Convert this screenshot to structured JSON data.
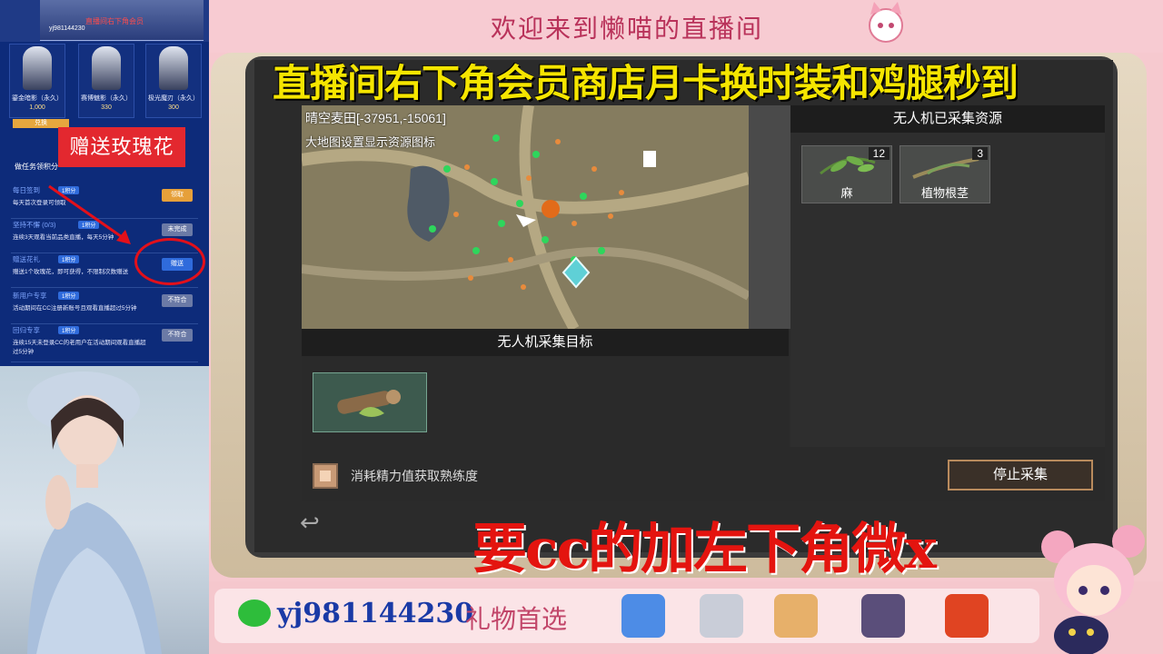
{
  "left_panel": {
    "top_banner_text": "yj981144230",
    "top_banner_red": "直播间右下角会员",
    "shop_items": [
      {
        "name": "鎏金暗影（永久）",
        "price": "1,000"
      },
      {
        "name": "赛博魅影（永久）",
        "price": "330"
      },
      {
        "name": "极光魔刃（永久）",
        "price": "300"
      }
    ],
    "exchange_label": "兑换",
    "rose_banner": "赠送玫瑰花",
    "task_section_title": "做任务领积分",
    "tasks": [
      {
        "name": "每日签到",
        "points": "1积分",
        "desc": "每天首次登录可领取",
        "button": "领取",
        "button_color": "#e6a03a"
      },
      {
        "name": "坚持不懈 (0/3)",
        "points": "1积分",
        "desc": "连续3天观看当前品类直播，每天5分钟",
        "button": "未完成",
        "button_color": "#6b7aa6"
      },
      {
        "name": "赠送花礼",
        "points": "1积分",
        "desc": "赠送1个玫瑰花，即可获得，不限制次数赠送",
        "button": "赠送",
        "button_color": "#2f6bdc"
      },
      {
        "name": "新用户专享",
        "points": "1积分",
        "desc": "活动期间在CC注册新账号且观看直播超过5分钟",
        "button": "不符合",
        "button_color": "#6b7aa6"
      },
      {
        "name": "回归专享",
        "points": "1积分",
        "desc": "连续15天未登录CC的老用户在活动期间观看直播超过5分钟",
        "button": "不符合",
        "button_color": "#6b7aa6"
      }
    ]
  },
  "top_banner": {
    "welcome": "欢迎来到懒喵的直播间"
  },
  "headline": "直播间右下角会员商店月卡换时装和鸡腿秒到",
  "game": {
    "map_coords": "晴空麦田[-37951,-15061]",
    "map_setting": "大地图设置显示资源图标",
    "collected_header": "无人机已采集资源",
    "resources": [
      {
        "name": "麻",
        "count": "12",
        "icon": "hemp-leaf-icon"
      },
      {
        "name": "植物根茎",
        "count": "3",
        "icon": "plant-root-icon"
      }
    ],
    "target_header": "无人机采集目标",
    "target_icon": "wood-log-icon",
    "checkbox_label": "消耗精力值获取熟练度",
    "stop_button": "停止采集",
    "back_icon": "↩"
  },
  "promo_red": "要cc的加左下角微x",
  "footer": {
    "wechat_id": "yj981144230",
    "gift_label": "礼物首选",
    "gifts": [
      "badge-gift-icon",
      "rabbit-gift-icon",
      "letter-gift-icon",
      "card-gift-icon",
      "lantern-gift-icon"
    ]
  },
  "colors": {
    "accent_yellow": "#f5e500",
    "promo_red": "#e4140f",
    "panel_blue": "#0d2b7a",
    "frame_pink": "#f6c9cf"
  }
}
